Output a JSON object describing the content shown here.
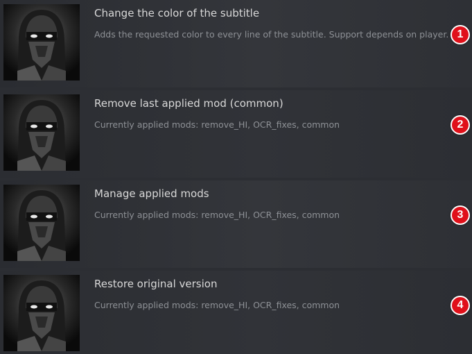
{
  "items": [
    {
      "title": "Change the color of the subtitle",
      "description": "Adds the requested color to every line of the subtitle. Support depends on player.",
      "badge": "1",
      "icon": "ninja-mask-thumbnail"
    },
    {
      "title": "Remove last applied mod (common)",
      "description": "Currently applied mods: remove_HI, OCR_fixes, common",
      "badge": "2",
      "icon": "ninja-mask-thumbnail"
    },
    {
      "title": "Manage applied mods",
      "description": "Currently applied mods: remove_HI, OCR_fixes, common",
      "badge": "3",
      "icon": "ninja-mask-thumbnail"
    },
    {
      "title": "Restore original version",
      "description": "Currently applied mods: remove_HI, OCR_fixes, common",
      "badge": "4",
      "icon": "ninja-mask-thumbnail"
    }
  ],
  "colors": {
    "background": "#2c2e33",
    "title": "#d9d9d9",
    "description": "#8e9196",
    "badge": "#e0101a"
  }
}
